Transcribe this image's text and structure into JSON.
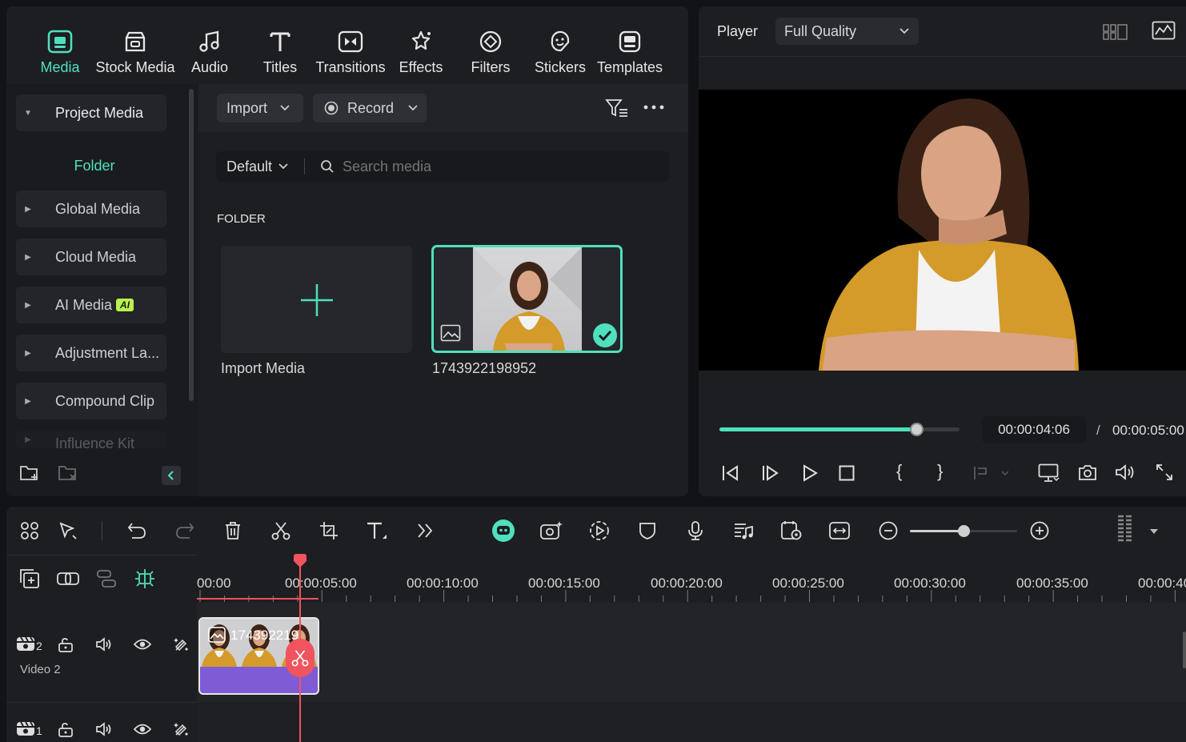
{
  "top_tabs": [
    {
      "label": "Media",
      "icon": "media-icon",
      "active": true
    },
    {
      "label": "Stock Media",
      "icon": "stock-media-icon"
    },
    {
      "label": "Audio",
      "icon": "audio-icon"
    },
    {
      "label": "Titles",
      "icon": "titles-icon"
    },
    {
      "label": "Transitions",
      "icon": "transitions-icon"
    },
    {
      "label": "Effects",
      "icon": "effects-icon"
    },
    {
      "label": "Filters",
      "icon": "filters-icon"
    },
    {
      "label": "Stickers",
      "icon": "stickers-icon"
    },
    {
      "label": "Templates",
      "icon": "templates-icon"
    }
  ],
  "sidebar": {
    "items": [
      {
        "label": "Project Media",
        "expanded": true
      },
      {
        "label": "Global Media"
      },
      {
        "label": "Cloud Media"
      },
      {
        "label": "AI Media",
        "badge": "AI"
      },
      {
        "label": "Adjustment La..."
      },
      {
        "label": "Compound Clip"
      },
      {
        "label": "Influence Kit"
      }
    ],
    "folder_label": "Folder"
  },
  "media_toolbar": {
    "import_label": "Import",
    "record_label": "Record",
    "sort_label": "Default",
    "search_placeholder": "Search media"
  },
  "media_grid": {
    "section_label": "FOLDER",
    "import_card_label": "Import Media",
    "items": [
      {
        "name": "1743922198952",
        "selected": true
      }
    ]
  },
  "player": {
    "label": "Player",
    "quality": "Full Quality",
    "current_time": "00:00:04:06",
    "separator": "/",
    "total_time": "00:00:05:00",
    "progress": 0.82
  },
  "timeline": {
    "zoom_level": 0.5,
    "ruler_labels": [
      "00:00",
      "00:00:05:00",
      "00:00:10:00",
      "00:00:15:00",
      "00:00:20:00",
      "00:00:25:00",
      "00:00:30:00",
      "00:00:35:00",
      "00:00:40"
    ],
    "tracks": [
      {
        "number": "2",
        "name": "Video 2"
      },
      {
        "number": "1",
        "name": ""
      }
    ],
    "clip_label": "174392219"
  },
  "colors": {
    "accent": "#4fe0bd",
    "playhead": "#f0545e",
    "clip_purple": "#7f5bd6",
    "ai_badge": "#b8f24d"
  }
}
